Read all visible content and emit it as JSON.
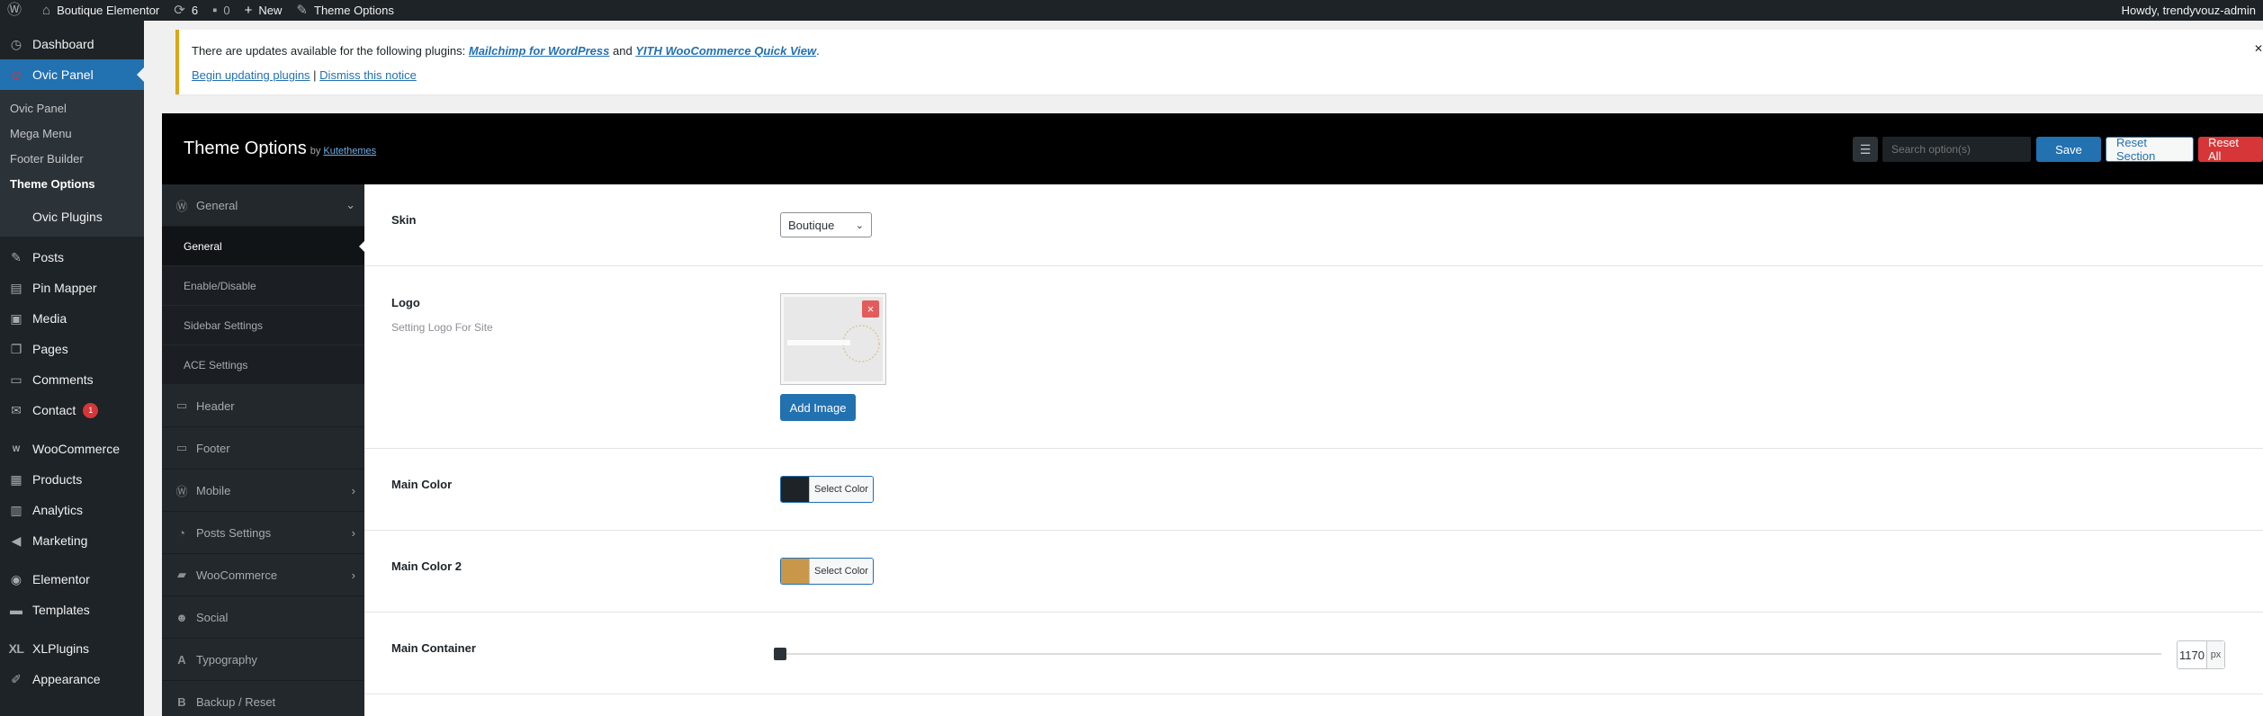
{
  "adminbar": {
    "site_name": "Boutique Elementor",
    "updates_count": "6",
    "comments_count": "0",
    "new_label": "New",
    "theme_options_label": "Theme Options",
    "howdy": "Howdy, trendyvouz-admin"
  },
  "sidebar": {
    "dashboard": "Dashboard",
    "ovic_panel": "Ovic Panel",
    "submenu": [
      "Ovic Panel",
      "Mega Menu",
      "Footer Builder",
      "Theme Options"
    ],
    "ovic_plugins": "Ovic Plugins",
    "posts": "Posts",
    "pin_mapper": "Pin Mapper",
    "media": "Media",
    "pages": "Pages",
    "comments": "Comments",
    "contact": "Contact",
    "contact_badge": "1",
    "woocommerce": "WooCommerce",
    "products": "Products",
    "analytics": "Analytics",
    "marketing": "Marketing",
    "elementor": "Elementor",
    "templates": "Templates",
    "xlplugins": "XLPlugins",
    "xl_icon_text": "XL",
    "appearance": "Appearance"
  },
  "notice": {
    "text_before": "There are updates available for the following plugins: ",
    "plugin1": "Mailchimp for WordPress",
    "and": " and ",
    "plugin2": "YITH WooCommerce Quick View",
    "period": ".",
    "begin_updating": "Begin updating plugins",
    "separator": " | ",
    "dismiss": "Dismiss this notice",
    "close_icon": "✕"
  },
  "options": {
    "title": "Theme Options",
    "by": "by",
    "author": "Kutethemes",
    "search_placeholder": "Search option(s)",
    "save": "Save",
    "reset_section": "Reset Section",
    "reset_all": "Reset All"
  },
  "nav": {
    "general": "General",
    "general_subs": [
      "General",
      "Enable/Disable",
      "Sidebar Settings",
      "ACE Settings"
    ],
    "header": "Header",
    "footer": "Footer",
    "mobile": "Mobile",
    "posts_settings": "Posts Settings",
    "woocommerce": "WooCommerce",
    "social": "Social",
    "typography": "Typography",
    "backup_reset": "Backup / Reset"
  },
  "fields": {
    "skin": {
      "label": "Skin",
      "value": "Boutique"
    },
    "logo": {
      "label": "Logo",
      "desc": "Setting Logo For Site",
      "add_image": "Add Image"
    },
    "main_color": {
      "label": "Main Color",
      "button": "Select Color",
      "color": "#1d2327"
    },
    "main_color_2": {
      "label": "Main Color 2",
      "button": "Select Color",
      "color": "#c9974a"
    },
    "main_container": {
      "label": "Main Container",
      "value": "1170",
      "unit": "px"
    }
  },
  "colors": {
    "admin_dark": "#1d2327",
    "wp_blue": "#2271b1",
    "danger": "#d63638",
    "notice_warning": "#dba617"
  }
}
